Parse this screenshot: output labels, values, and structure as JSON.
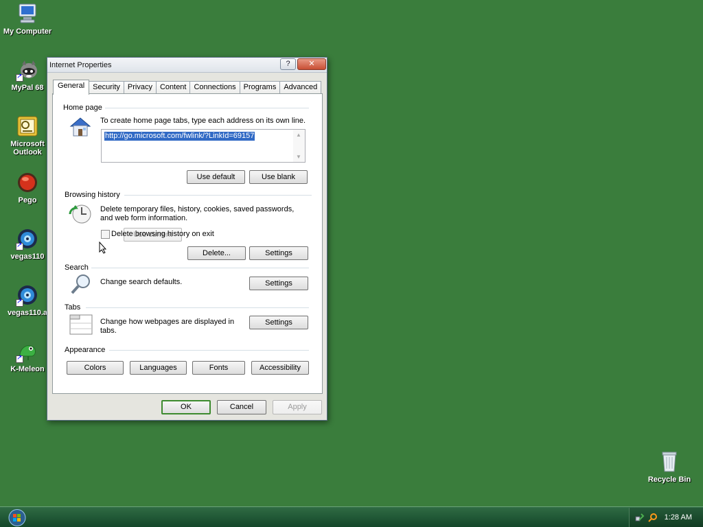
{
  "desktop": {
    "icons": [
      {
        "label": "My Computer",
        "icon": "computer-icon"
      },
      {
        "label": "MyPal 68",
        "icon": "raccoon-browser-icon"
      },
      {
        "label": "Microsoft Outlook",
        "icon": "outlook-icon"
      },
      {
        "label": "Pego",
        "icon": "red-orb-icon"
      },
      {
        "label": "vegas110",
        "icon": "media-disc-icon"
      },
      {
        "label": "vegas110.a",
        "icon": "media-disc-icon"
      },
      {
        "label": "K-Meleon",
        "icon": "chameleon-icon"
      },
      {
        "label": "Recycle Bin",
        "icon": "recycle-bin-icon"
      }
    ]
  },
  "window": {
    "title": "Internet Properties",
    "help_label": "?",
    "close_label": "✕",
    "tabs": [
      "General",
      "Security",
      "Privacy",
      "Content",
      "Connections",
      "Programs",
      "Advanced"
    ],
    "active_tab": "General",
    "home_page": {
      "heading": "Home page",
      "description": "To create home page tabs, type each address on its own line.",
      "url": "http://go.microsoft.com/fwlink/?LinkId=69157",
      "use_current": "Use current",
      "use_default": "Use default",
      "use_blank": "Use blank"
    },
    "browsing_history": {
      "heading": "Browsing history",
      "description_line1": "Delete temporary files, history, cookies, saved passwords,",
      "description_line2": "and web form information.",
      "checkbox_label": "Delete browsing history on exit",
      "checkbox_checked": false,
      "delete_button": "Delete...",
      "settings_button": "Settings"
    },
    "search": {
      "heading": "Search",
      "description": "Change search defaults.",
      "settings_button": "Settings"
    },
    "tabs_section": {
      "heading": "Tabs",
      "description_line1": "Change how webpages are displayed in",
      "description_line2": "tabs.",
      "settings_button": "Settings"
    },
    "appearance": {
      "heading": "Appearance",
      "colors": "Colors",
      "languages": "Languages",
      "fonts": "Fonts",
      "accessibility": "Accessibility"
    },
    "footer": {
      "ok": "OK",
      "cancel": "Cancel",
      "apply": "Apply"
    }
  },
  "taskbar": {
    "clock": "1:28 AM"
  },
  "colors": {
    "desktop": "#3a7d3c",
    "taskbar": "#1e5534",
    "selection": "#316ac5"
  }
}
